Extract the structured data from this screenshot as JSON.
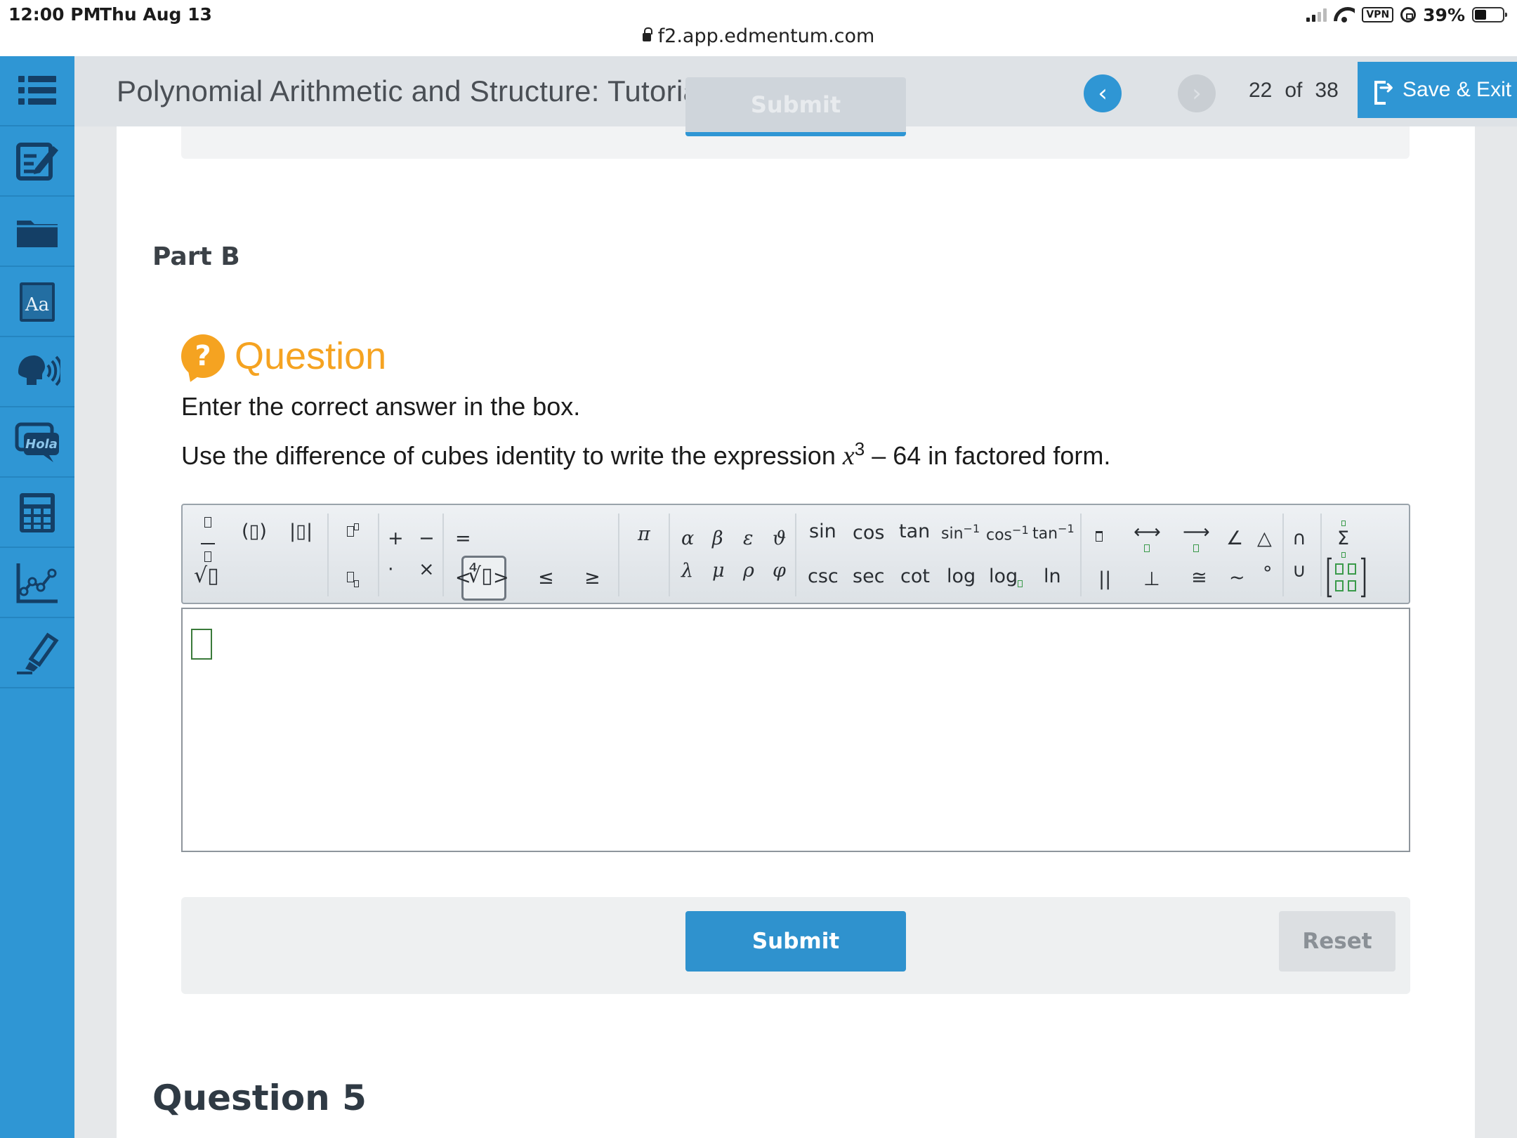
{
  "status_bar": {
    "time": "12:00 PM",
    "date": "Thu Aug 13",
    "url": "f2.app.edmentum.com",
    "vpn_label": "VPN",
    "battery": "39%"
  },
  "sidebar": {
    "items": [
      {
        "icon": "list-icon"
      },
      {
        "icon": "notepad-edit-icon"
      },
      {
        "icon": "folder-icon"
      },
      {
        "icon": "dictionary-icon",
        "text": "Aa"
      },
      {
        "icon": "text-to-speech-icon"
      },
      {
        "icon": "translate-icon",
        "text": "Hola"
      },
      {
        "icon": "calculator-icon"
      },
      {
        "icon": "graph-icon"
      },
      {
        "icon": "highlighter-icon"
      }
    ]
  },
  "header": {
    "title": "Polynomial Arithmetic and Structure: Tutorial",
    "page_current": "22",
    "page_of": "of",
    "page_total": "38",
    "save_exit": "Save & Exit",
    "prev_glyph": "‹",
    "next_glyph": "›"
  },
  "ghost_submit": "Submit",
  "part_label": "Part B",
  "question": {
    "label": "Question",
    "badge": "?",
    "instruction": "Enter the correct answer in the box.",
    "prompt_before": "Use the difference of cubes identity to write the expression ",
    "prompt_var": "x",
    "prompt_exp": "3",
    "prompt_after": " – 64 in factored form."
  },
  "toolbar": {
    "paren": "(▯)",
    "abs": "|▯|",
    "sqrt": "√▯",
    "nthroot": "∜▯",
    "plus": "+",
    "minus": "−",
    "equals": "=",
    "dot": "·",
    "times": "×",
    "lt": "<",
    "gt": ">",
    "le": "≤",
    "ge": "≥",
    "pi": "π",
    "greek_top": [
      "α",
      "β",
      "ε",
      "ϑ"
    ],
    "greek_bottom": [
      "λ",
      "μ",
      "ρ",
      "φ"
    ],
    "trig_top": [
      "sin",
      "cos",
      "tan"
    ],
    "inv_trig": [
      "sin",
      "cos",
      "tan"
    ],
    "inv_exp": "−1",
    "trig_bottom": [
      "csc",
      "sec",
      "cot"
    ],
    "log": "log",
    "log_base": "log",
    "ln": "ln",
    "line": "⟷",
    "ray": "⟶",
    "angle": "∠",
    "triangle": "△",
    "parallel": "||",
    "perp": "⊥",
    "congruent": "≅",
    "similar": "~",
    "degree": "°",
    "intersect": "∩",
    "union": "∪",
    "sigma": "Σ"
  },
  "buttons": {
    "submit": "Submit",
    "reset": "Reset"
  },
  "next_section": "Question 5"
}
